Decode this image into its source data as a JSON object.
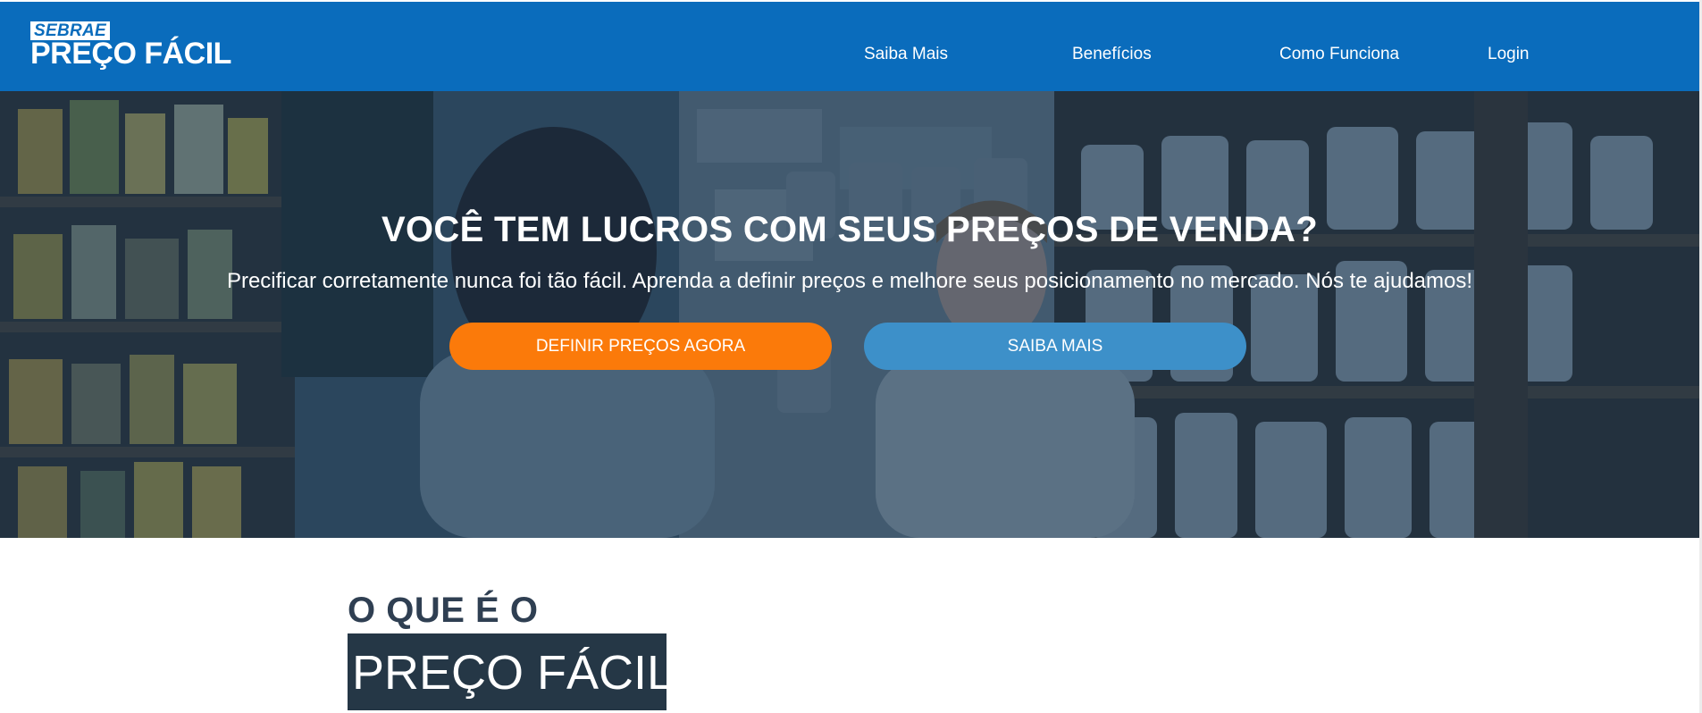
{
  "brand": {
    "small": "SEBRAE",
    "large": "PREÇO FÁCIL"
  },
  "nav": {
    "items": [
      {
        "label": "Saiba Mais"
      },
      {
        "label": "Benefícios"
      },
      {
        "label": "Como Funciona"
      },
      {
        "label": "Login"
      }
    ]
  },
  "hero": {
    "title": "VOCÊ TEM LUCROS COM SEUS PREÇOS DE VENDA?",
    "subtitle": "Precificar corretamente nunca foi tão fácil. Aprenda a definir preços e melhore seus posicionamento no mercado. Nós te ajudamos!",
    "primary_button": "DEFINIR PREÇOS AGORA",
    "secondary_button": "SAIBA MAIS"
  },
  "about": {
    "pre_heading": "O QUE É O",
    "heading": "PREÇO FÁCIL"
  },
  "colors": {
    "nav_bg": "#0a6cbc",
    "primary_button": "#fb7a0a",
    "secondary_button": "#3d90c9",
    "heading_dark": "#253746"
  }
}
